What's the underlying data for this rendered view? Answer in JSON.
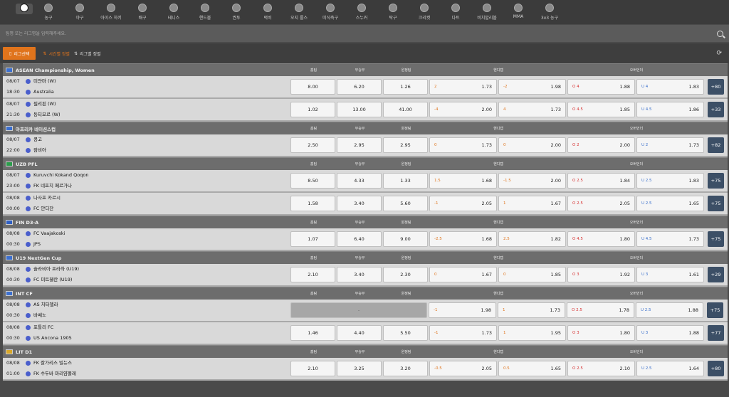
{
  "sports": [
    {
      "label": "",
      "icon": "soccer-ball-icon",
      "active": true
    },
    {
      "label": "농구",
      "icon": "basketball-icon"
    },
    {
      "label": "야구",
      "icon": "baseball-icon"
    },
    {
      "label": "아이스 하키",
      "icon": "hockey-stick-icon"
    },
    {
      "label": "배구",
      "icon": "volleyball-icon"
    },
    {
      "label": "테니스",
      "icon": "tennis-ball-icon"
    },
    {
      "label": "핸드볼",
      "icon": "handball-icon"
    },
    {
      "label": "권투",
      "icon": "boxing-glove-icon"
    },
    {
      "label": "럭비",
      "icon": "rugby-ball-icon"
    },
    {
      "label": "오지 룰스",
      "icon": "aussie-rules-icon"
    },
    {
      "label": "미식축구",
      "icon": "american-football-icon"
    },
    {
      "label": "스누커",
      "icon": "snooker-icon"
    },
    {
      "label": "탁구",
      "icon": "table-tennis-icon"
    },
    {
      "label": "크리켓",
      "icon": "cricket-icon"
    },
    {
      "label": "다트",
      "icon": "darts-icon"
    },
    {
      "label": "비치발리볼",
      "icon": "beach-volleyball-icon"
    },
    {
      "label": "MMA",
      "icon": "mma-icon"
    },
    {
      "label": "3x3 농구",
      "icon": "basketball-3x3-icon"
    }
  ],
  "search": {
    "placeholder": "팀명 또는 리그명을 입력해주세요."
  },
  "toolbar": {
    "league_select": "리그선택",
    "sort_time": "시간별 정렬",
    "sort_league": "리그별 정렬"
  },
  "columns": {
    "home": "홈팀",
    "draw": "무승부",
    "away": "원정팀",
    "handicap": "핸디캡",
    "overunder": "오버언더"
  },
  "leagues": [
    {
      "name": "ASEAN Championship, Women",
      "flag": "#3b6fcf",
      "games": [
        {
          "date": "08/07",
          "time": "18:30",
          "home": "미얀마 (W)",
          "away": "Australia",
          "h": "8.00",
          "d": "6.20",
          "a": "1.26",
          "hcl": "2",
          "hch": "1.73",
          "hcr": "-2",
          "hca": "1.98",
          "ol": "O 4",
          "oo": "1.88",
          "ul": "U 4",
          "uo": "1.83",
          "more": "+80"
        },
        {
          "date": "08/07",
          "time": "21:30",
          "home": "필리핀 (W)",
          "away": "동티모르 (W)",
          "h": "1.02",
          "d": "13.00",
          "a": "41.00",
          "hcl": "-4",
          "hch": "2.00",
          "hcr": "4",
          "hca": "1.73",
          "ol": "O 4.5",
          "oo": "1.85",
          "ul": "U 4.5",
          "uo": "1.86",
          "more": "+33"
        }
      ]
    },
    {
      "name": "아프리카 네이션스컵",
      "flag": "#3b6fcf",
      "games": [
        {
          "date": "08/07",
          "time": "22:00",
          "home": "콩고",
          "away": "잠비아",
          "h": "2.50",
          "d": "2.95",
          "a": "2.95",
          "hcl": "0",
          "hch": "1.73",
          "hcr": "0",
          "hca": "2.00",
          "ol": "O 2",
          "oo": "2.00",
          "ul": "U 2",
          "uo": "1.73",
          "more": "+82"
        }
      ]
    },
    {
      "name": "UZB PFL",
      "flag": "#2a9c4a",
      "games": [
        {
          "date": "08/07",
          "time": "23:00",
          "home": "Kuruvchi Kokand Qoqon",
          "away": "FK 네프치 페르가나",
          "h": "8.50",
          "d": "4.33",
          "a": "1.33",
          "hcl": "1.5",
          "hch": "1.68",
          "hcr": "-1.5",
          "hca": "2.00",
          "ol": "O 2.5",
          "oo": "1.84",
          "ul": "U 2.5",
          "uo": "1.83",
          "more": "+75"
        },
        {
          "date": "08/08",
          "time": "00:00",
          "home": "나사프 카르시",
          "away": "FC 안디잔",
          "h": "1.58",
          "d": "3.40",
          "a": "5.60",
          "hcl": "-1",
          "hch": "2.05",
          "hcr": "1",
          "hca": "1.67",
          "ol": "O 2.5",
          "oo": "2.05",
          "ul": "U 2.5",
          "uo": "1.65",
          "more": "+75"
        }
      ]
    },
    {
      "name": "FIN D3-A",
      "flag": "#2f5fc4",
      "games": [
        {
          "date": "08/08",
          "time": "00:30",
          "home": "FC Vaajakoski",
          "away": "JPS",
          "h": "1.07",
          "d": "6.40",
          "a": "9.00",
          "hcl": "-2.5",
          "hch": "1.68",
          "hcr": "2.5",
          "hca": "1.82",
          "ol": "O 4.5",
          "oo": "1.80",
          "ul": "U 4.5",
          "uo": "1.73",
          "more": "+75"
        }
      ]
    },
    {
      "name": "U19 NextGen Cup",
      "flag": "#3b6fcf",
      "games": [
        {
          "date": "08/08",
          "time": "00:30",
          "home": "슬라비아 프라하 (U19)",
          "away": "FC 미트웰란 (U19)",
          "h": "2.10",
          "d": "3.40",
          "a": "2.30",
          "hcl": "0",
          "hch": "1.67",
          "hcr": "0",
          "hca": "1.85",
          "ol": "O 3",
          "oo": "1.92",
          "ul": "U 3",
          "uo": "1.61",
          "more": "+29"
        }
      ]
    },
    {
      "name": "INT CF",
      "flag": "#3b6fcf",
      "games": [
        {
          "date": "08/08",
          "time": "00:30",
          "home": "AS 치타델라",
          "away": "바쎄노",
          "h": "",
          "d": "-",
          "a": "",
          "disabled": true,
          "hcl": "-1",
          "hch": "1.98",
          "hcr": "1",
          "hca": "1.73",
          "ol": "O 2.5",
          "oo": "1.78",
          "ul": "U 2.5",
          "uo": "1.88",
          "more": "+75"
        },
        {
          "date": "08/08",
          "time": "00:30",
          "home": "포틀리 FC",
          "away": "US Ancona 1905",
          "h": "1.46",
          "d": "4.40",
          "a": "5.50",
          "hcl": "-1",
          "hch": "1.73",
          "hcr": "1",
          "hca": "1.95",
          "ol": "O 3",
          "oo": "1.80",
          "ul": "U 3",
          "uo": "1.88",
          "more": "+77"
        }
      ]
    },
    {
      "name": "LIT D1",
      "flag": "#d9a82a",
      "games": [
        {
          "date": "08/08",
          "time": "01:00",
          "home": "FK 잘가리스 빌뉴스",
          "away": "FK 수두바 마리얌폴레",
          "h": "2.10",
          "d": "3.25",
          "a": "3.20",
          "hcl": "-0.5",
          "hch": "2.05",
          "hcr": "0.5",
          "hca": "1.65",
          "ol": "O 2.5",
          "oo": "2.10",
          "ul": "U 2.5",
          "uo": "1.64",
          "more": "+80"
        }
      ]
    }
  ]
}
